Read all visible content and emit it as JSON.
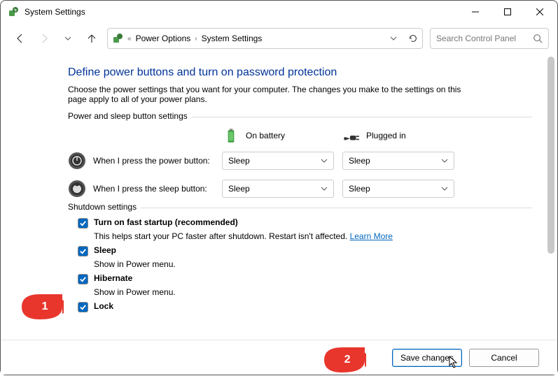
{
  "window": {
    "title": "System Settings",
    "min": "Minimize",
    "max": "Maximize",
    "close": "Close"
  },
  "nav": {
    "crumb_root": "Power Options",
    "crumb_leaf": "System Settings",
    "search_placeholder": "Search Control Panel"
  },
  "main": {
    "heading": "Define power buttons and turn on password protection",
    "desc": "Choose the power settings that you want for your computer. The changes you make to the settings on this page apply to all of your power plans.",
    "group1_legend": "Power and sleep button settings",
    "col_battery": "On battery",
    "col_plugged": "Plugged in",
    "row_power_label": "When I press the power button:",
    "row_sleep_label": "When I press the sleep button:",
    "sel_power_batt": "Sleep",
    "sel_power_plug": "Sleep",
    "sel_sleep_batt": "Sleep",
    "sel_sleep_plug": "Sleep",
    "group2_legend": "Shutdown settings",
    "chk_fast_label": "Turn on fast startup (recommended)",
    "chk_fast_desc": "This helps start your PC faster after shutdown. Restart isn't affected. ",
    "learn_more": "Learn More",
    "chk_sleep_label": "Sleep",
    "chk_sleep_desc": "Show in Power menu.",
    "chk_hibernate_label": "Hibernate",
    "chk_hibernate_desc": "Show in Power menu.",
    "chk_lock_label": "Lock"
  },
  "footer": {
    "save": "Save changes",
    "cancel": "Cancel"
  },
  "callouts": {
    "n1": "1",
    "n2": "2"
  }
}
